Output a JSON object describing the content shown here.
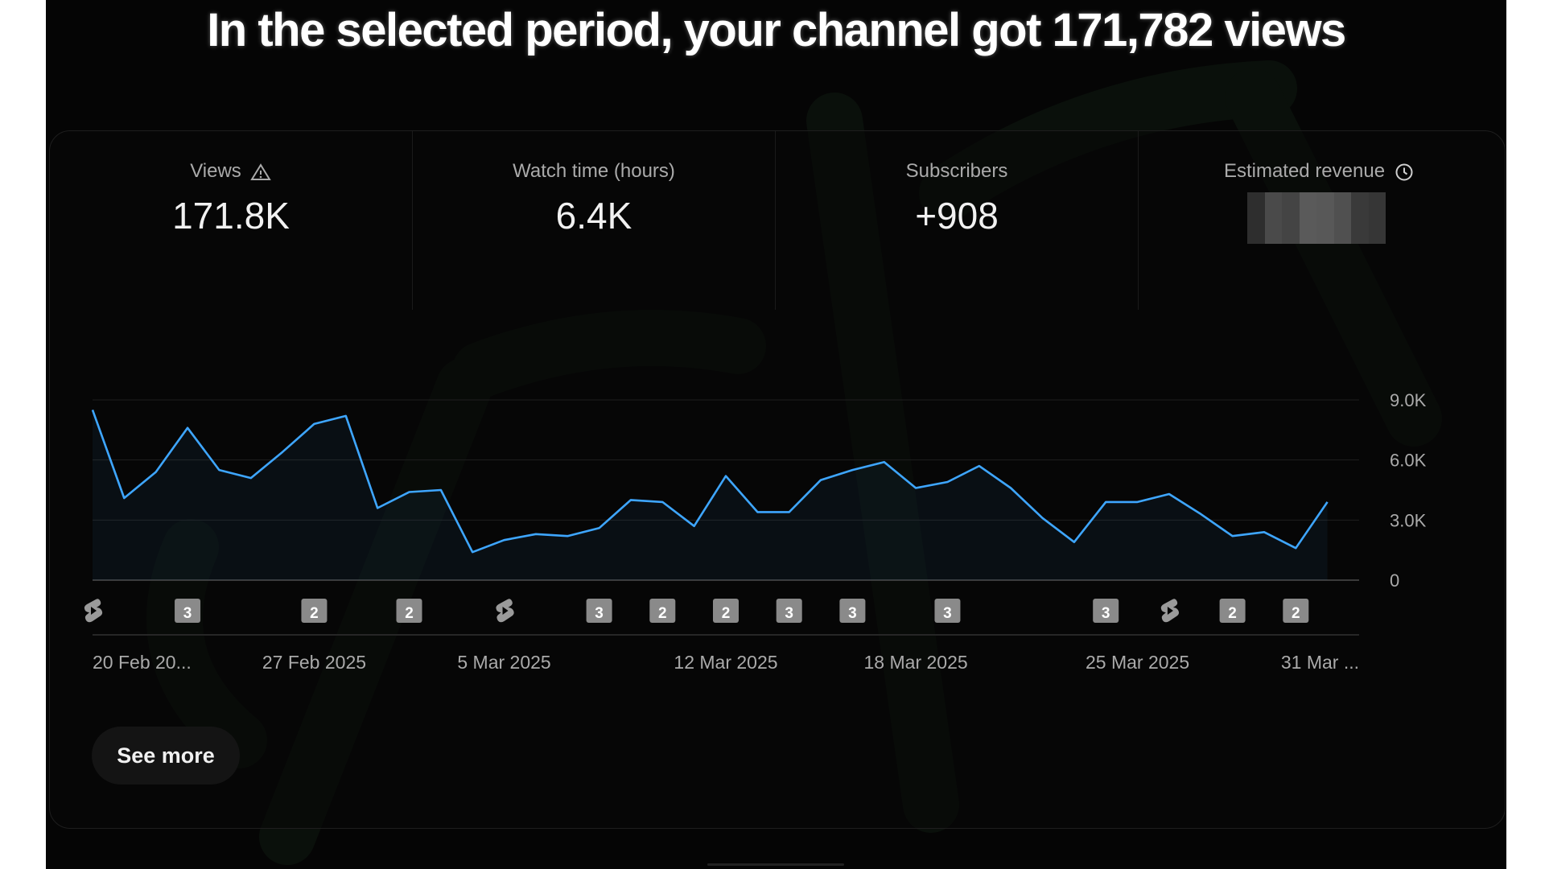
{
  "headline": "In the selected period, your channel got 171,782 views",
  "metrics": [
    {
      "label": "Views",
      "value": "171.8K",
      "icon": "warning-icon"
    },
    {
      "label": "Watch time (hours)",
      "value": "6.4K",
      "icon": ""
    },
    {
      "label": "Subscribers",
      "value": "+908",
      "icon": ""
    },
    {
      "label": "Estimated revenue",
      "value": "",
      "icon": "clock-icon"
    }
  ],
  "colors": {
    "line": "#3ea6ff",
    "background": "#050505",
    "grid": "#1f1f1f",
    "axis_text": "#aaaaaa",
    "badge": "#8a8a8a"
  },
  "chart_data": {
    "type": "line",
    "ylim": [
      0,
      9000
    ],
    "y_ticks": [
      {
        "value": 0,
        "label": "0"
      },
      {
        "value": 3000,
        "label": "3.0K"
      },
      {
        "value": 6000,
        "label": "6.0K"
      },
      {
        "value": 9000,
        "label": "9.0K"
      }
    ],
    "x_range": [
      "2025-02-20",
      "2025-04-01"
    ],
    "x_tick_labels": [
      {
        "date": "2025-02-20",
        "label": "20 Feb 20..."
      },
      {
        "date": "2025-02-27",
        "label": "27 Feb 2025"
      },
      {
        "date": "2025-03-05",
        "label": "5 Mar 2025"
      },
      {
        "date": "2025-03-12",
        "label": "12 Mar 2025"
      },
      {
        "date": "2025-03-18",
        "label": "18 Mar 2025"
      },
      {
        "date": "2025-03-25",
        "label": "25 Mar 2025"
      },
      {
        "date": "2025-03-31",
        "label": "31 Mar ..."
      }
    ],
    "series": [
      {
        "points": [
          [
            "2025-02-20",
            8500
          ],
          [
            "2025-02-21",
            4100
          ],
          [
            "2025-02-22",
            5400
          ],
          [
            "2025-02-23",
            7600
          ],
          [
            "2025-02-24",
            5500
          ],
          [
            "2025-02-25",
            5100
          ],
          [
            "2025-02-26",
            6400
          ],
          [
            "2025-02-27",
            7800
          ],
          [
            "2025-02-28",
            8200
          ],
          [
            "2025-03-01",
            3600
          ],
          [
            "2025-03-02",
            4400
          ],
          [
            "2025-03-03",
            4500
          ],
          [
            "2025-03-04",
            1400
          ],
          [
            "2025-03-05",
            2000
          ],
          [
            "2025-03-06",
            2300
          ],
          [
            "2025-03-07",
            2200
          ],
          [
            "2025-03-08",
            2600
          ],
          [
            "2025-03-09",
            4000
          ],
          [
            "2025-03-10",
            3900
          ],
          [
            "2025-03-11",
            2700
          ],
          [
            "2025-03-12",
            5200
          ],
          [
            "2025-03-13",
            3400
          ],
          [
            "2025-03-14",
            3400
          ],
          [
            "2025-03-15",
            5000
          ],
          [
            "2025-03-16",
            5500
          ],
          [
            "2025-03-17",
            5900
          ],
          [
            "2025-03-18",
            4600
          ],
          [
            "2025-03-19",
            4900
          ],
          [
            "2025-03-20",
            5700
          ],
          [
            "2025-03-21",
            4600
          ],
          [
            "2025-03-22",
            3100
          ],
          [
            "2025-03-23",
            1900
          ],
          [
            "2025-03-24",
            3900
          ],
          [
            "2025-03-25",
            3900
          ],
          [
            "2025-03-26",
            4300
          ],
          [
            "2025-03-27",
            3300
          ],
          [
            "2025-03-28",
            2200
          ],
          [
            "2025-03-29",
            2400
          ],
          [
            "2025-03-30",
            1600
          ],
          [
            "2025-03-31",
            3900
          ]
        ]
      }
    ],
    "publish_markers": [
      {
        "date": "2025-02-20",
        "kind": "shorts-icon",
        "label": ""
      },
      {
        "date": "2025-02-23",
        "kind": "badge",
        "label": "3"
      },
      {
        "date": "2025-02-27",
        "kind": "badge",
        "label": "2"
      },
      {
        "date": "2025-03-02",
        "kind": "badge",
        "label": "2"
      },
      {
        "date": "2025-03-05",
        "kind": "shorts-icon",
        "label": ""
      },
      {
        "date": "2025-03-08",
        "kind": "badge",
        "label": "3"
      },
      {
        "date": "2025-03-10",
        "kind": "badge",
        "label": "2"
      },
      {
        "date": "2025-03-12",
        "kind": "badge",
        "label": "2"
      },
      {
        "date": "2025-03-14",
        "kind": "badge",
        "label": "3"
      },
      {
        "date": "2025-03-16",
        "kind": "badge",
        "label": "3"
      },
      {
        "date": "2025-03-19",
        "kind": "badge",
        "label": "3"
      },
      {
        "date": "2025-03-24",
        "kind": "badge",
        "label": "3"
      },
      {
        "date": "2025-03-26",
        "kind": "shorts-icon",
        "label": ""
      },
      {
        "date": "2025-03-28",
        "kind": "badge",
        "label": "2"
      },
      {
        "date": "2025-03-30",
        "kind": "badge",
        "label": "2"
      }
    ]
  },
  "see_more_label": "See more"
}
